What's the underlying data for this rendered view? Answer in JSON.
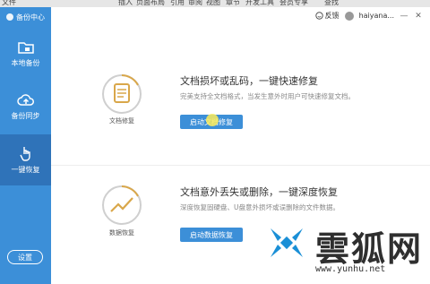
{
  "menu_strip": [
    "文件",
    "插入",
    "页面布局",
    "引用",
    "审阅",
    "视图",
    "章节",
    "开发工具",
    "会员专享",
    "查找"
  ],
  "app": {
    "title": "备份中心"
  },
  "nav": [
    {
      "label": "本地备份"
    },
    {
      "label": "备份同步"
    },
    {
      "label": "一键恢复"
    }
  ],
  "settings_label": "设置",
  "header": {
    "feedback": "反馈",
    "user": "haiyana..."
  },
  "features": [
    {
      "icon_label": "文档修复",
      "title": "文档损坏或乱码，一键快速修复",
      "desc": "完美支持全文档格式，当发生意外时用户可快速修复文档。",
      "button": "启动文档修复"
    },
    {
      "icon_label": "数据恢复",
      "title": "文档意外丢失或删除，一键深度恢复",
      "desc": "深度恢复固硬盘、U盘意外损坏或误删除的文件数据。",
      "button": "启动数据恢复"
    }
  ],
  "watermark": {
    "name": "雲狐网",
    "url": "www.yunhu.net"
  },
  "colors": {
    "sidebar": "#3c8fd8",
    "sidebar_active": "#2f73b9",
    "button": "#3c8fd8",
    "icon_ring": "#d9a74a"
  }
}
